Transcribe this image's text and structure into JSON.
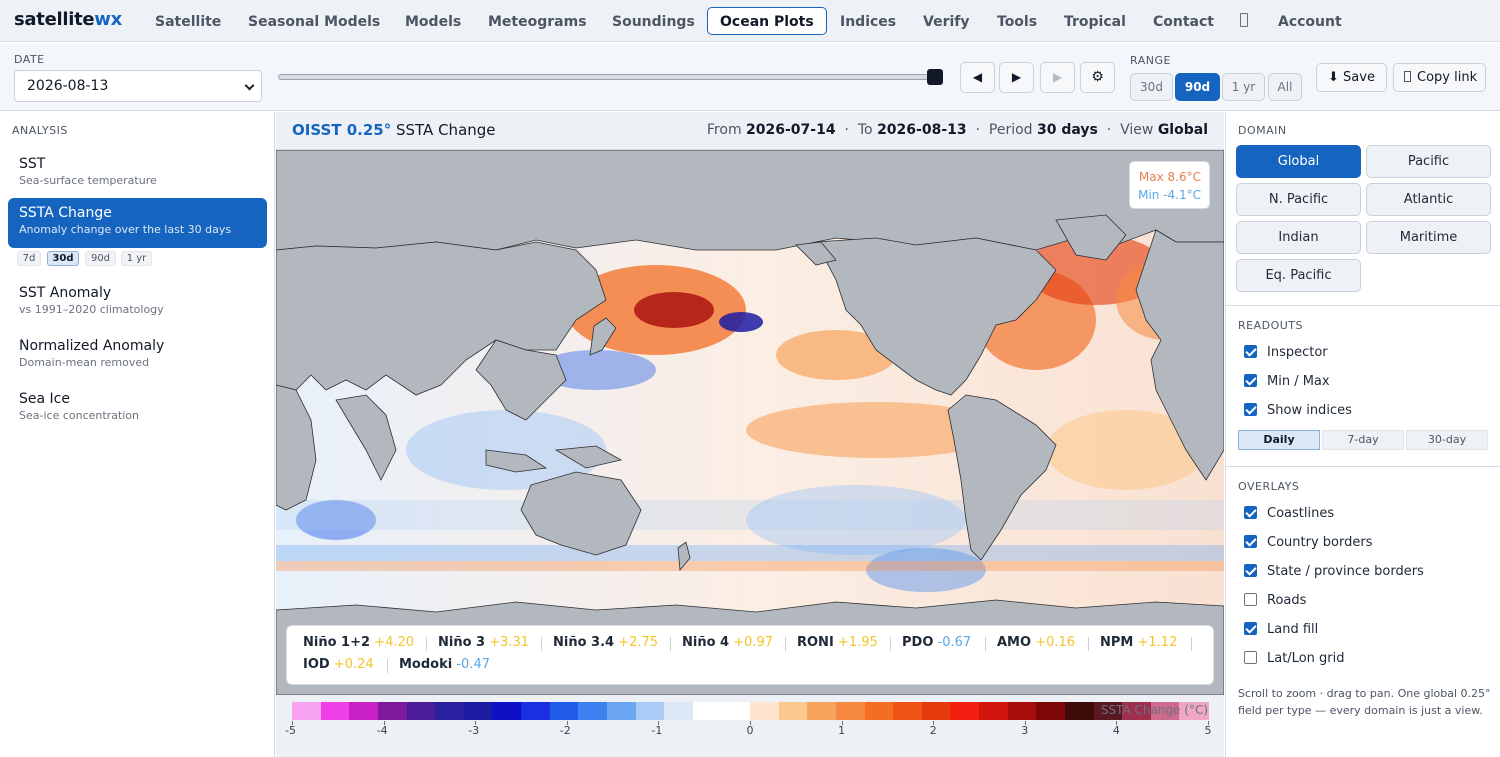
{
  "brand": {
    "name": "satellite",
    "suffix": "wx"
  },
  "nav": {
    "items": [
      "Satellite",
      "Seasonal Models",
      "Models",
      "Meteograms",
      "Soundings",
      "Ocean Plots",
      "Indices",
      "Verify",
      "Tools",
      "Tropical",
      "Contact"
    ],
    "active": "Ocean Plots",
    "account": "Account"
  },
  "controls": {
    "date_label": "DATE",
    "date_value": "2026-08-13",
    "range_label": "RANGE",
    "range_options": [
      "30d",
      "90d",
      "1 yr",
      "All"
    ],
    "range_active": "90d",
    "slider_position": 1.0,
    "prev_glyph": "◀",
    "play_glyph": "▶",
    "next_glyph": "▶",
    "gear_glyph": "⚙",
    "save_label": "⬇ Save",
    "copy_label": "Copy link"
  },
  "sidebar": {
    "section": "ANALYSIS",
    "items": [
      {
        "title": "SST",
        "subtitle": "Sea-surface temperature"
      },
      {
        "title": "SSTA Change",
        "subtitle": "Anomaly change over the last 30 days",
        "active": true
      },
      {
        "title": "SST Anomaly",
        "subtitle": "vs 1991–2020 climatology"
      },
      {
        "title": "Normalized Anomaly",
        "subtitle": "Domain-mean removed"
      },
      {
        "title": "Sea Ice",
        "subtitle": "Sea-ice concentration"
      }
    ],
    "periods": [
      "7d",
      "30d",
      "90d",
      "1 yr"
    ],
    "period_active": "30d"
  },
  "map": {
    "product": "OISST 0.25°",
    "field": "SSTA Change",
    "from_label": "From",
    "from_date": "2026-07-14",
    "to_label": "To",
    "to_date": "2026-08-13",
    "period_label": "Period",
    "period_value": "30 days",
    "view_label": "View",
    "view_value": "Global",
    "max_text": "Max 8.6°C",
    "min_text": "Min -4.1°C",
    "colorbar_label": "SSTA Change (°C)",
    "colorbar_ticks": [
      "-5",
      "-4",
      "-3",
      "-2",
      "-1",
      "0",
      "1",
      "2",
      "3",
      "4",
      "5"
    ],
    "colorbar_colors": [
      "#f7a3f2",
      "#ee3fe8",
      "#c81fc6",
      "#7d1a9a",
      "#4a1c9a",
      "#2a1f9f",
      "#1c1ca3",
      "#0e10c5",
      "#1a2fe0",
      "#1f5ae8",
      "#3b82f0",
      "#6aa6f2",
      "#a9cbf5",
      "#dde9f8",
      "#ffffff",
      "#ffffff",
      "#fde4cf",
      "#fbc98f",
      "#f8a45e",
      "#f6893f",
      "#f36d23",
      "#ef5414",
      "#e53b0c",
      "#f41f10",
      "#d4140f",
      "#a80d0b",
      "#7d0707",
      "#3e0a0a",
      "#5a1822",
      "#9e2f4d",
      "#ce6b8c",
      "#efa7c4"
    ],
    "land_color": "#b3b8bf"
  },
  "indices": [
    {
      "name": "Niño 1+2",
      "value": "+4.20",
      "sign": "pos"
    },
    {
      "name": "Niño 3",
      "value": "+3.31",
      "sign": "pos"
    },
    {
      "name": "Niño 3.4",
      "value": "+2.75",
      "sign": "pos"
    },
    {
      "name": "Niño 4",
      "value": "+0.97",
      "sign": "pos"
    },
    {
      "name": "RONI",
      "value": "+1.95",
      "sign": "pos"
    },
    {
      "name": "PDO",
      "value": "-0.67",
      "sign": "neg"
    },
    {
      "name": "AMO",
      "value": "+0.16",
      "sign": "pos"
    },
    {
      "name": "NPM",
      "value": "+1.12",
      "sign": "pos"
    },
    {
      "name": "IOD",
      "value": "+0.24",
      "sign": "pos"
    },
    {
      "name": "Modoki",
      "value": "-0.47",
      "sign": "neg"
    }
  ],
  "right": {
    "domain_title": "DOMAIN",
    "domains": [
      "Global",
      "Pacific",
      "N. Pacific",
      "Atlantic",
      "Indian",
      "Maritime",
      "Eq. Pacific"
    ],
    "domain_active": "Global",
    "readouts_title": "READOUTS",
    "readouts": [
      {
        "label": "Inspector",
        "checked": true
      },
      {
        "label": "Min / Max",
        "checked": true
      },
      {
        "label": "Show indices",
        "checked": true
      }
    ],
    "index_periods": [
      "Daily",
      "7-day",
      "30-day"
    ],
    "index_period_active": "Daily",
    "overlays_title": "OVERLAYS",
    "overlays": [
      {
        "label": "Coastlines",
        "checked": true
      },
      {
        "label": "Country borders",
        "checked": true
      },
      {
        "label": "State / province borders",
        "checked": true
      },
      {
        "label": "Roads",
        "checked": false
      },
      {
        "label": "Land fill",
        "checked": true
      },
      {
        "label": "Lat/Lon grid",
        "checked": false
      }
    ],
    "help": "Scroll to zoom · drag to pan. One global 0.25° field per type — every domain is just a view."
  }
}
